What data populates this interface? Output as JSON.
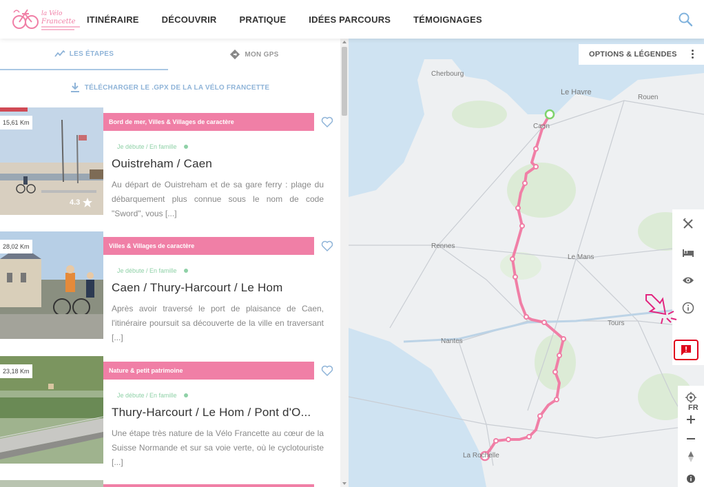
{
  "header": {
    "logo_text": "la Vélo Francette",
    "nav": [
      "ITINÉRAIRE",
      "DÉCOUVRIR",
      "PRATIQUE",
      "IDÉES PARCOURS",
      "TÉMOIGNAGES"
    ],
    "search_icon": "search-icon"
  },
  "tabs": [
    {
      "label": "LES ÉTAPES",
      "icon": "chart-line-icon",
      "active": true
    },
    {
      "label": "MON GPS",
      "icon": "navigation-diamond-icon",
      "active": false
    }
  ],
  "download_label": "TÉLÉCHARGER LE .GPX DE LA LA VÉLO FRANCETTE",
  "stages": [
    {
      "distance": "15,61 Km",
      "rating": "4.3",
      "tag": "Bord de mer, Villes & Villages de caractère",
      "level": "Je débute / En famille",
      "title": "Ouistreham / Caen",
      "description": "Au départ de Ouistreham et de sa gare ferry : plage du débarquement plus connue sous le nom de code \"Sword\", vous [...]"
    },
    {
      "distance": "28,02 Km",
      "tag": "Villes & Villages de caractère",
      "level": "Je débute / En famille",
      "title": "Caen / Thury-Harcourt / Le Hom",
      "description": "Après avoir traversé le port de plaisance de Caen, l'itinéraire poursuit sa découverte de la ville en traversant [...]"
    },
    {
      "distance": "23,18 Km",
      "tag": "Nature & petit patrimoine",
      "level": "Je débute / En famille",
      "title": "Thury-Harcourt / Le Hom / Pont d'O...",
      "description": "Une étape très nature de la Vélo Francette au cœur de la Suisse Normande et sur sa voie verte, où le cyclotouriste [...]"
    }
  ],
  "map": {
    "options_label": "OPTIONS & LÉGENDES",
    "cities": [
      "Cherbourg",
      "Le Havre",
      "Rouen",
      "Caen",
      "Rennes",
      "Le Mans",
      "Nantes",
      "Tours",
      "La Rochelle"
    ],
    "route_color": "#f07fa6",
    "country_label": "FR",
    "side_tools": [
      "fork-knife-icon",
      "bed-icon",
      "eye-icon",
      "info-icon"
    ],
    "report_icon": "report-alert-icon",
    "report_color": "#e0001b",
    "controls": [
      "locate-icon",
      "zoom-in-icon",
      "zoom-out-icon",
      "compass-icon",
      "attribution-info-icon"
    ]
  }
}
